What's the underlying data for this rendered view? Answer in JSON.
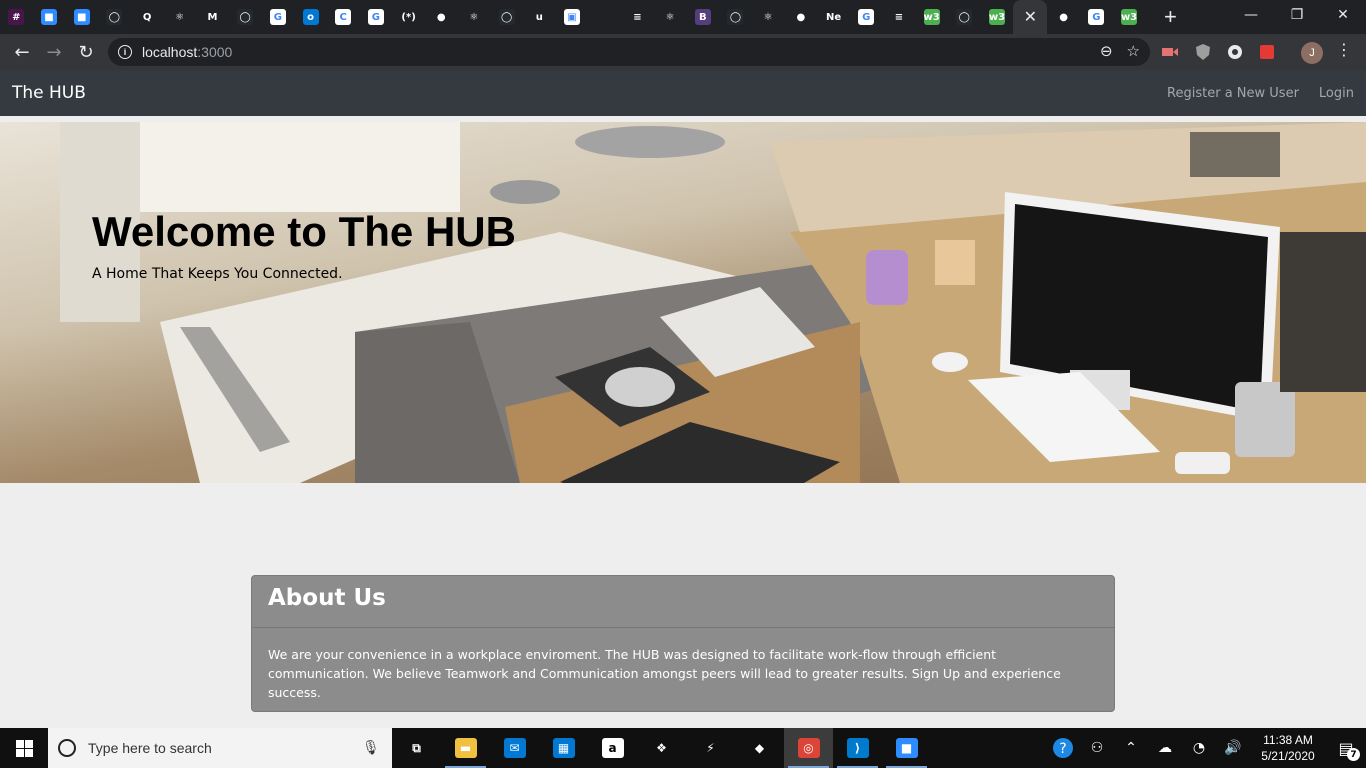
{
  "browser": {
    "tabs": [
      {
        "icon": "slack-icon",
        "color": "#4a154b",
        "glyph": "#"
      },
      {
        "icon": "zoom-icon",
        "color": "#2d8cff",
        "glyph": "■"
      },
      {
        "icon": "zoom-icon",
        "color": "#2d8cff",
        "glyph": "■"
      },
      {
        "icon": "github-icon",
        "color": "#24292e",
        "glyph": "◯"
      },
      {
        "icon": "quora-icon",
        "color": "#202124",
        "glyph": "Q"
      },
      {
        "icon": "react-icon",
        "color": "#202124",
        "glyph": "⚛"
      },
      {
        "icon": "medium-icon",
        "color": "#202124",
        "glyph": "M"
      },
      {
        "icon": "github-icon",
        "color": "#24292e",
        "glyph": "◯"
      },
      {
        "icon": "google-icon",
        "color": "#ffffff",
        "glyph": "G"
      },
      {
        "icon": "outlook-icon",
        "color": "#0078d4",
        "glyph": "o"
      },
      {
        "icon": "doc-icon",
        "color": "#ffffff",
        "glyph": "C"
      },
      {
        "icon": "google-icon",
        "color": "#ffffff",
        "glyph": "G"
      },
      {
        "icon": "regex-icon",
        "color": "#202124",
        "glyph": "(*)"
      },
      {
        "icon": "globe-icon",
        "color": "#202124",
        "glyph": "●"
      },
      {
        "icon": "react-icon",
        "color": "#202124",
        "glyph": "⚛"
      },
      {
        "icon": "github-icon",
        "color": "#24292e",
        "glyph": "◯"
      },
      {
        "icon": "udemy-icon",
        "color": "#202124",
        "glyph": "u"
      },
      {
        "icon": "camera-icon",
        "color": "#ffffff",
        "glyph": "▣"
      },
      {
        "icon": "blank-icon",
        "color": "#202124",
        "glyph": ""
      },
      {
        "icon": "stackoverflow-icon",
        "color": "#202124",
        "glyph": "≡"
      },
      {
        "icon": "react-icon",
        "color": "#202124",
        "glyph": "⚛"
      },
      {
        "icon": "bootstrap-icon",
        "color": "#563d7c",
        "glyph": "B"
      },
      {
        "icon": "github-icon",
        "color": "#24292e",
        "glyph": "◯"
      },
      {
        "icon": "react-icon",
        "color": "#202124",
        "glyph": "⚛"
      },
      {
        "icon": "globe-icon",
        "color": "#202124",
        "glyph": "●"
      },
      {
        "icon": "netlify-icon",
        "color": "#202124",
        "glyph": "Ne"
      },
      {
        "icon": "google-icon",
        "color": "#ffffff",
        "glyph": "G"
      },
      {
        "icon": "stackoverflow-icon",
        "color": "#202124",
        "glyph": "≡"
      },
      {
        "icon": "w3schools-icon",
        "color": "#4caf50",
        "glyph": "w3"
      },
      {
        "icon": "github-icon",
        "color": "#24292e",
        "glyph": "◯"
      },
      {
        "icon": "w3schools-icon",
        "color": "#4caf50",
        "glyph": "w3"
      }
    ],
    "active_tab_close": "✕",
    "tabs_after": [
      {
        "icon": "globe-icon",
        "color": "#202124",
        "glyph": "●"
      },
      {
        "icon": "google-icon",
        "color": "#ffffff",
        "glyph": "G"
      },
      {
        "icon": "w3schools-icon",
        "color": "#4caf50",
        "glyph": "w3"
      }
    ],
    "new_tab": "+",
    "window_controls": {
      "minimize": "—",
      "restore": "❐",
      "close": "✕"
    },
    "url_host": "localhost",
    "url_port": ":3000",
    "profile_initial": "J"
  },
  "app": {
    "brand": "The HUB",
    "nav": {
      "register": "Register a New User",
      "login": "Login"
    },
    "hero": {
      "title": "Welcome to The HUB",
      "subtitle": "A Home That Keeps You Connected."
    },
    "about": {
      "heading": "About Us",
      "body": "We are your convenience in a workplace enviroment. The HUB was designed to facilitate work-flow through efficient communication. We believe Teamwork and Communication amongst peers will lead to greater results. Sign Up and experience success."
    }
  },
  "taskbar": {
    "search_placeholder": "Type here to search",
    "apps": [
      {
        "name": "task-view",
        "color": "#101010",
        "glyph": "⧉"
      },
      {
        "name": "file-explorer",
        "color": "#f0c040",
        "glyph": "▬"
      },
      {
        "name": "mail",
        "color": "#0078d4",
        "glyph": "✉"
      },
      {
        "name": "store",
        "color": "#0078d4",
        "glyph": "▦"
      },
      {
        "name": "amazon",
        "color": "#ffffff",
        "glyph": "a"
      },
      {
        "name": "dropbox",
        "color": "#101010",
        "glyph": "❖"
      },
      {
        "name": "azure-data-studio",
        "color": "#101010",
        "glyph": "⚡"
      },
      {
        "name": "gitkraken",
        "color": "#101010",
        "glyph": "◆"
      },
      {
        "name": "chrome",
        "color": "#db4437",
        "glyph": "◎"
      },
      {
        "name": "vscode",
        "color": "#007acc",
        "glyph": "⟩"
      },
      {
        "name": "zoom",
        "color": "#2d8cff",
        "glyph": "■"
      }
    ],
    "time": "11:38 AM",
    "date": "5/21/2020",
    "notification_count": "7"
  }
}
